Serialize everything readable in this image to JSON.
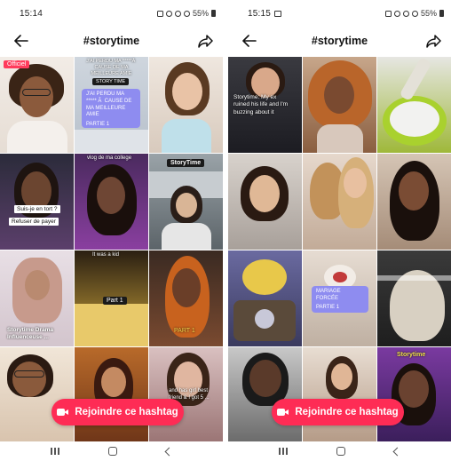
{
  "left_screen": {
    "status": {
      "time": "15:14",
      "battery": "55%"
    },
    "header": {
      "title": "#storytime"
    },
    "tiles": [
      {
        "badge": "Officiel"
      },
      {
        "caption_top": "J'AI PERDU MA *****Ă  CAUSE DE MA MEILLEURE AMIE",
        "label": "STORY TIME",
        "card": "J'AI PERDU MA ***** Ă  CAUSE DE MA MEILLEURE AMIE",
        "card_sub": "PARTIE 1"
      },
      {
        "caption": ""
      },
      {
        "caption": "Suis-je en tort ?",
        "caption2": "Refuser de payer"
      },
      {
        "caption": "vlog de ma college"
      },
      {
        "caption": "StoryTime"
      },
      {
        "caption": "Storytime Drama Influenceuse ..."
      },
      {
        "caption": "It was a kid",
        "caption2": "Part 1"
      },
      {
        "caption": "PART 1"
      },
      {
        "caption": ""
      },
      {
        "caption": ""
      },
      {
        "caption": "and has girl best friend & I got 5 ..."
      }
    ],
    "cta": {
      "label": "Rejoindre ce hashtag"
    }
  },
  "right_screen": {
    "status": {
      "time": "15:15",
      "battery": "55%"
    },
    "header": {
      "title": "#storytime"
    },
    "tiles": [
      {
        "caption": "Storytime: My ex ruined his life and I'm buzzing about it"
      },
      {
        "caption": ""
      },
      {
        "caption": ""
      },
      {
        "caption": ""
      },
      {
        "caption": ""
      },
      {
        "caption": ""
      },
      {
        "caption": ""
      },
      {
        "card": "MARIAGE FORCÉE",
        "card_sub": "PARTIE 1"
      },
      {
        "caption": ""
      },
      {
        "caption": ""
      },
      {
        "caption": ""
      },
      {
        "caption": "Storytime"
      }
    ],
    "cta": {
      "label": "Rejoindre ce hashtag"
    }
  },
  "icons": {
    "back": "arrow-left-icon",
    "share": "share-arrow-icon",
    "camera": "video-camera-icon",
    "recents": "recents-icon",
    "home": "home-icon",
    "nav_back": "chevron-left-icon"
  },
  "colors": {
    "accent": "#fe2c55",
    "lavender": "#8e8cf0"
  }
}
